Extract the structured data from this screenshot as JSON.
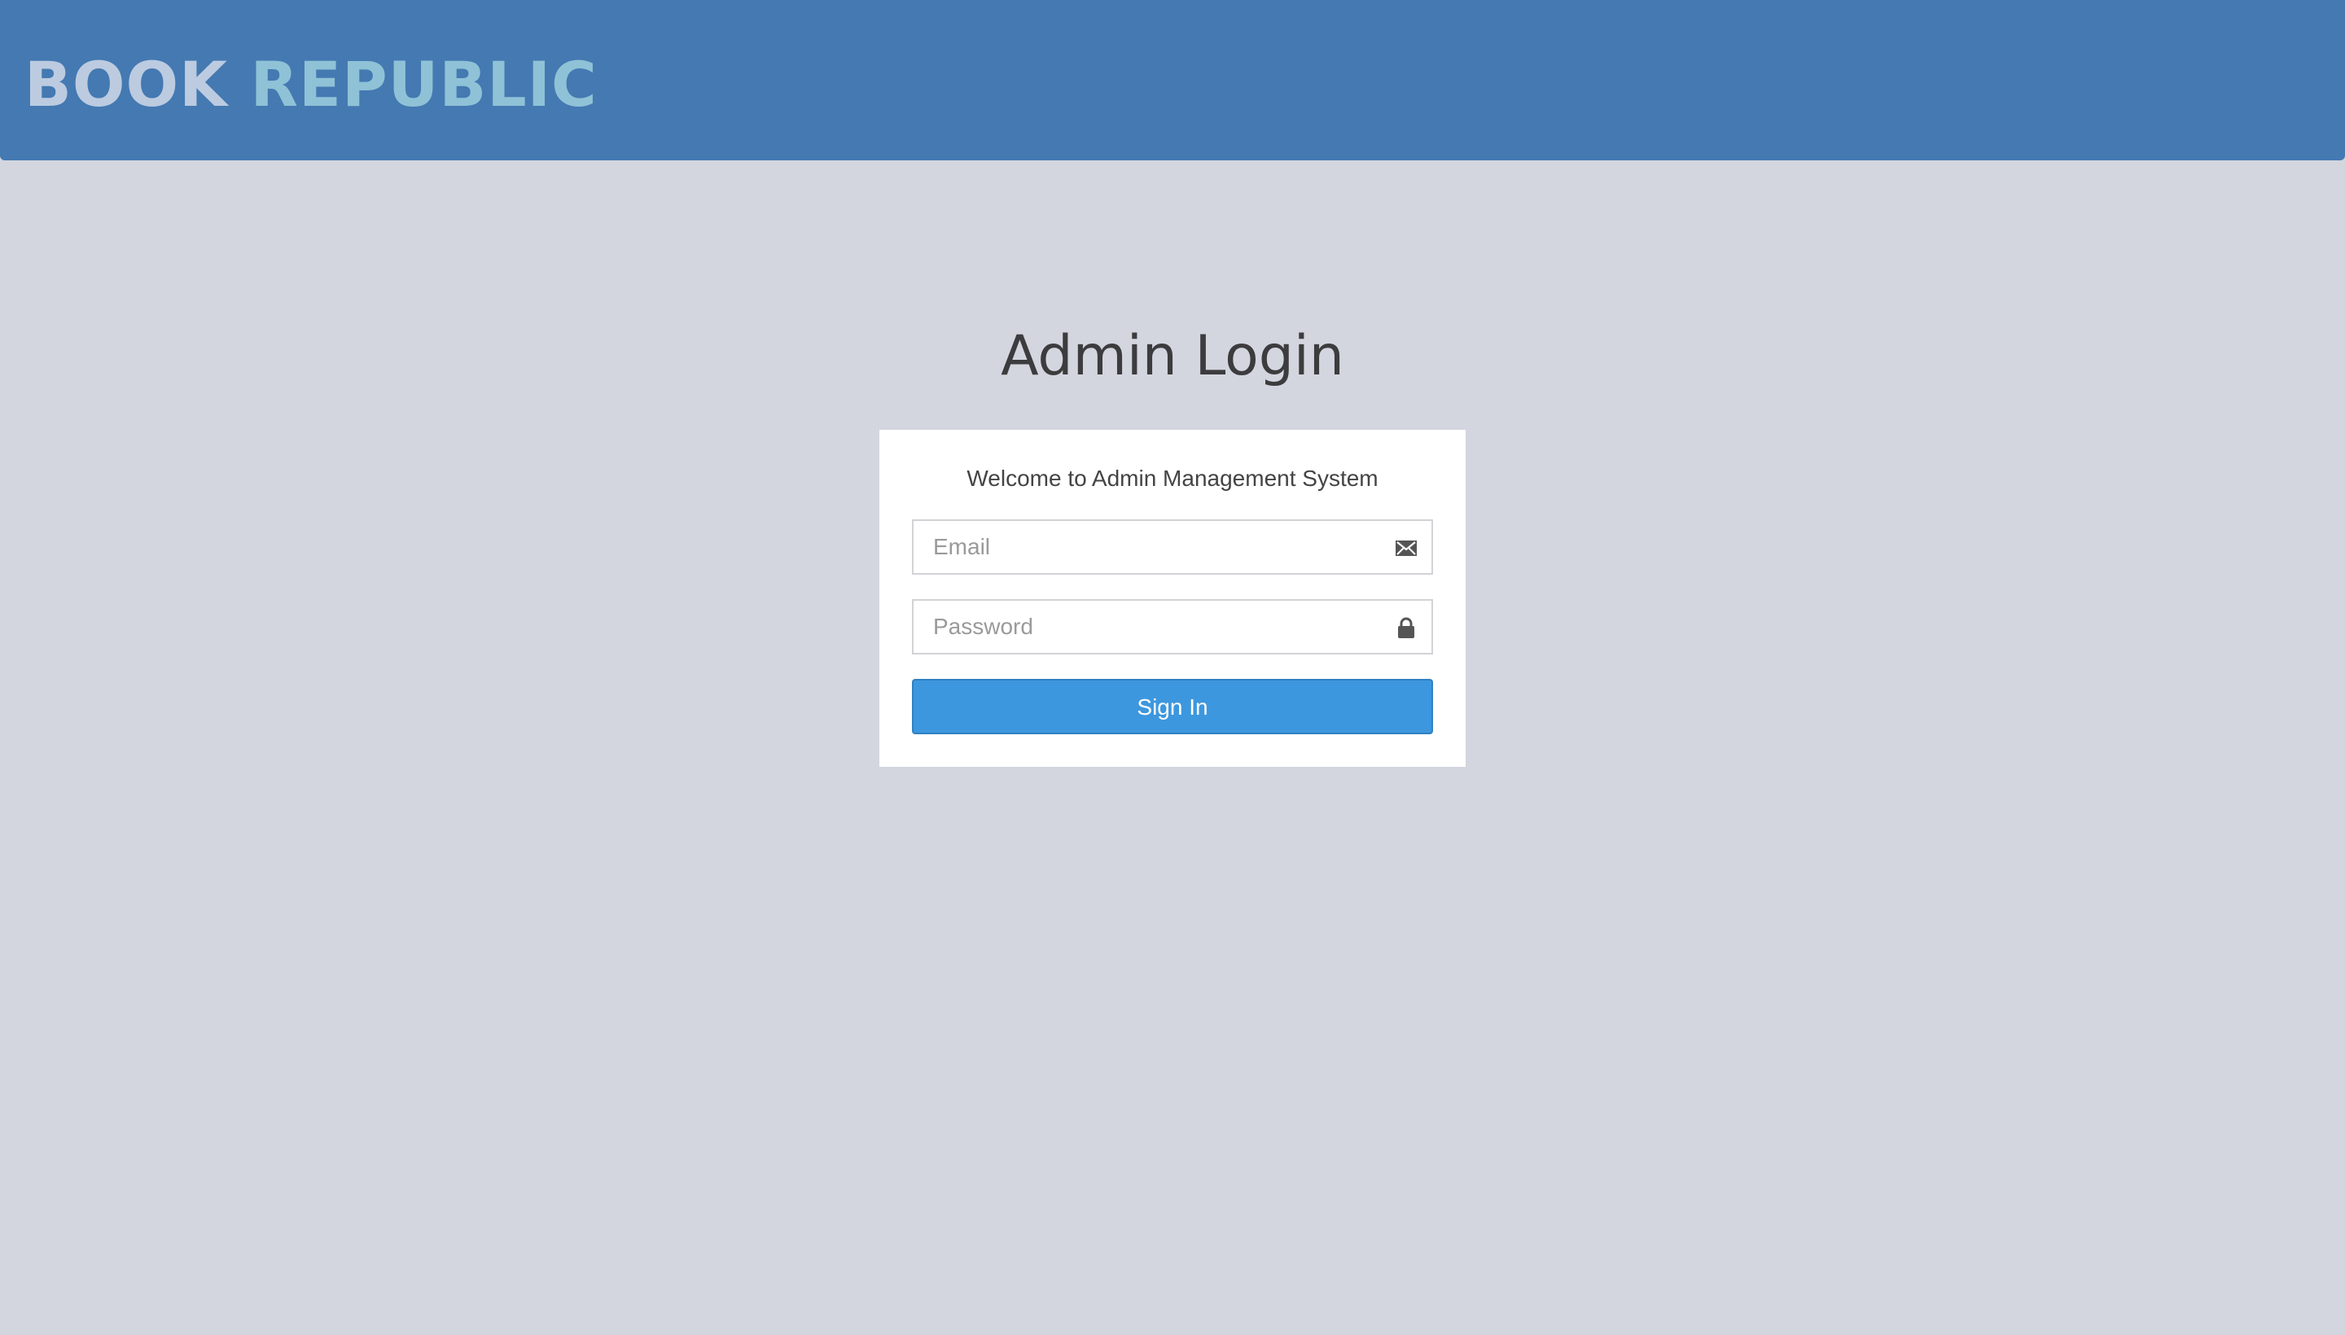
{
  "header": {
    "brand_word1": "BOOK",
    "brand_word2": "REPUBLIC"
  },
  "login": {
    "title": "Admin Login",
    "welcome": "Welcome to Admin Management System",
    "email_placeholder": "Email",
    "email_icon": "envelope-icon",
    "password_placeholder": "Password",
    "password_icon": "lock-icon",
    "sign_in_label": "Sign In"
  },
  "colors": {
    "header_bg": "#4479b2",
    "page_bg": "#d3d6df",
    "brand_word1": "#bccbe0",
    "brand_word2": "#8fc2d6",
    "button_bg": "#3d97de"
  }
}
